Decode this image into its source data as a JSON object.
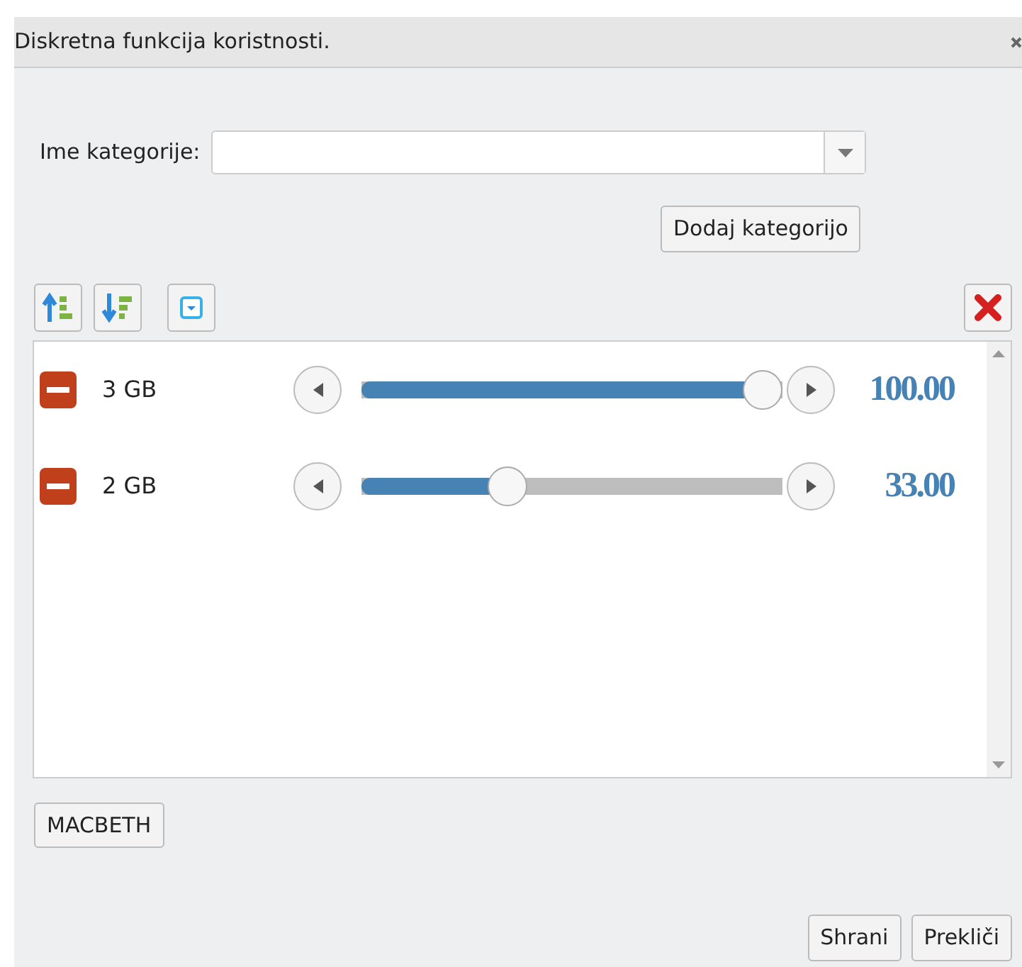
{
  "window": {
    "title": "Diskretna funkcija koristnosti."
  },
  "category": {
    "label": "Ime kategorije:"
  },
  "add_button": "Dodaj kategorijo",
  "items": [
    {
      "name": "3 GB",
      "level": 1.0,
      "reading": "100.00"
    },
    {
      "name": "2 GB",
      "level": 0.33,
      "reading": "33.00"
    }
  ],
  "macbeth_button": "MACBETH",
  "buttons": [
    "Shrani",
    "Prekliči"
  ]
}
